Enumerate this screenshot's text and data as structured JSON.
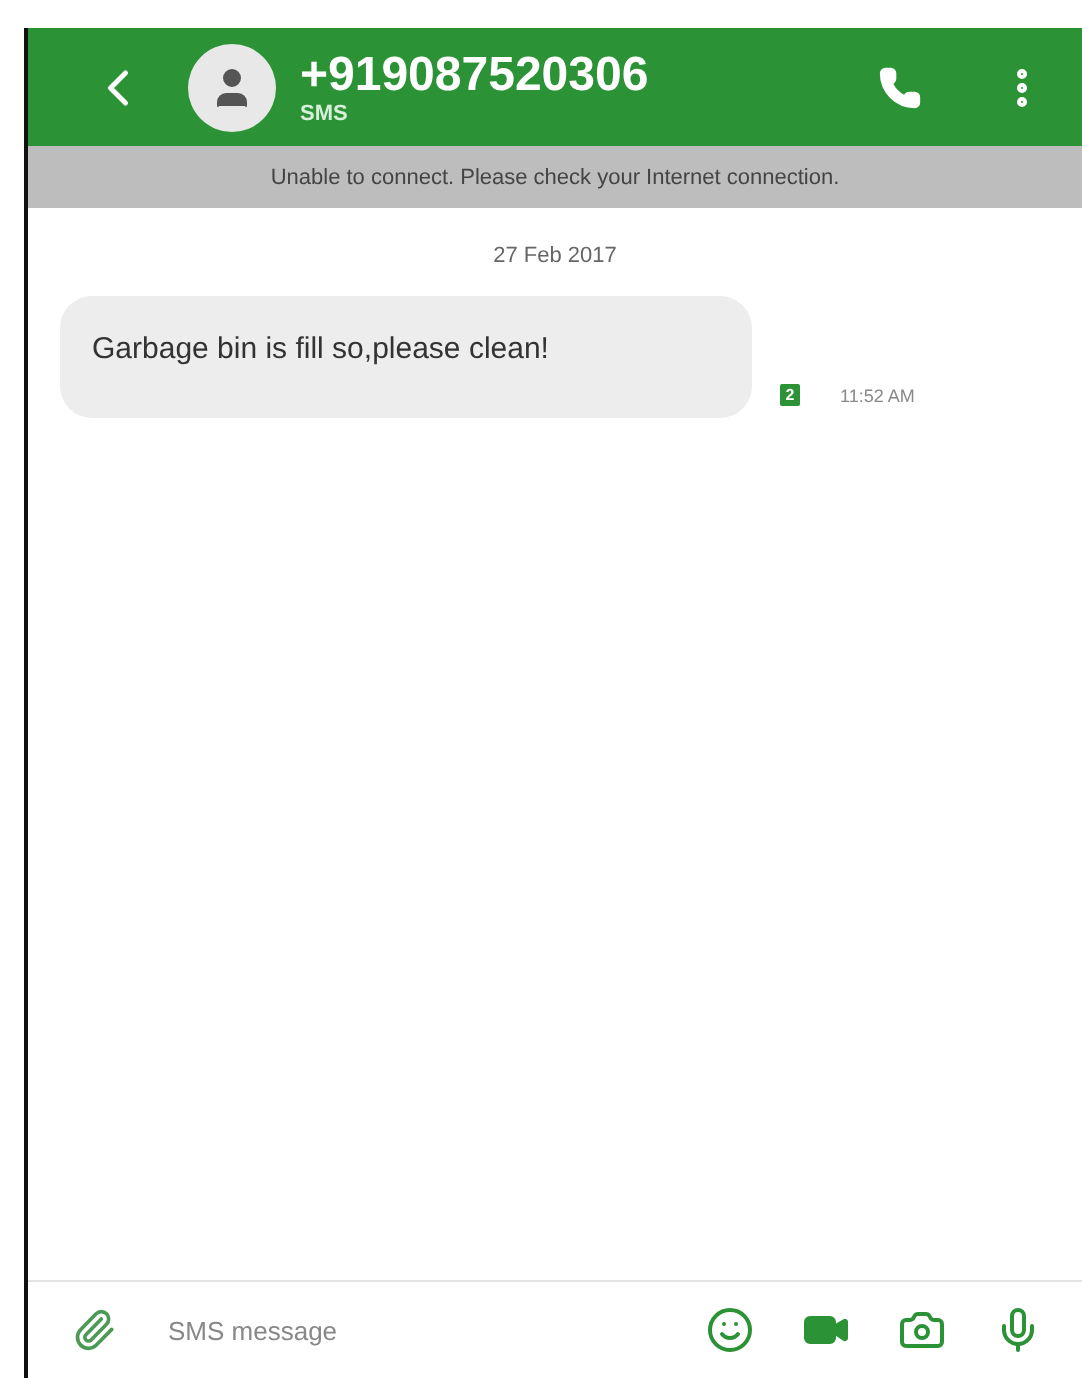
{
  "header": {
    "title": "+919087520306",
    "subtitle": "SMS"
  },
  "banner": "Unable to connect. Please check your Internet connection.",
  "date": "27 Feb 2017",
  "messages": [
    {
      "text": "Garbage bin is fill so,please clean!",
      "sim": "2",
      "time": "11:52 AM"
    }
  ],
  "composer": {
    "placeholder": "SMS message"
  }
}
